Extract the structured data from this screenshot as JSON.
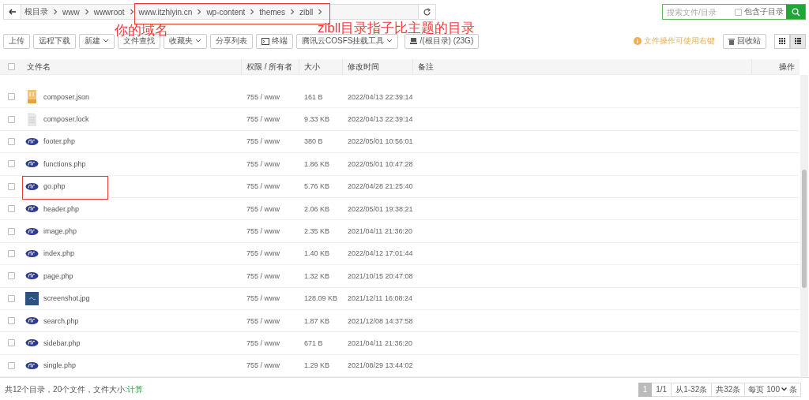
{
  "breadcrumb": {
    "segments": [
      "根目录",
      "www",
      "wwwroot",
      "www.itzhiyin.cn",
      "wp-content",
      "themes",
      "zibll"
    ]
  },
  "search": {
    "placeholder": "搜索文件/目录",
    "subdir_label": "包含子目录",
    "subdir_checked": false
  },
  "toolbar": {
    "buttons": [
      {
        "label": "上传",
        "kind": "plain"
      },
      {
        "label": "远程下载",
        "kind": "plain"
      },
      {
        "label": "新建",
        "kind": "dropdown"
      },
      {
        "label": "文件查找",
        "kind": "plain"
      },
      {
        "label": "收藏夹",
        "kind": "dropdown"
      },
      {
        "label": "分享列表",
        "kind": "plain"
      },
      {
        "label": "终端",
        "kind": "terminal"
      },
      {
        "label": "腾讯云COSFS挂载工具",
        "kind": "dropdown"
      },
      {
        "label": "/(根目录) (23G)",
        "kind": "disk"
      }
    ],
    "tip": "文件操作可使用右键",
    "recycle": "回收站",
    "views": [
      {
        "kind": "grid",
        "selected": false
      },
      {
        "kind": "list",
        "selected": true
      }
    ]
  },
  "table": {
    "select_all_checked": false,
    "columns": [
      "文件名",
      "权限 / 所有者",
      "大小",
      "修改时间",
      "备注",
      "操作"
    ],
    "rows": [
      {
        "name": "composer.json",
        "kind": "json",
        "perm": "755 / www",
        "size": "161 B",
        "mtime": "2022/04/13 22:39:14",
        "checked": false
      },
      {
        "name": "composer.lock",
        "kind": "file",
        "perm": "755 / www",
        "size": "9.33 KB",
        "mtime": "2022/04/13 22:39:14",
        "checked": false
      },
      {
        "name": "footer.php",
        "kind": "php",
        "perm": "755 / www",
        "size": "380 B",
        "mtime": "2022/05/01 10:56:01",
        "checked": false
      },
      {
        "name": "functions.php",
        "kind": "php",
        "perm": "755 / www",
        "size": "1.86 KB",
        "mtime": "2022/05/01 10:47:28",
        "checked": false
      },
      {
        "name": "go.php",
        "kind": "php",
        "perm": "755 / www",
        "size": "5.76 KB",
        "mtime": "2022/04/28 21:25:40",
        "checked": false
      },
      {
        "name": "header.php",
        "kind": "php",
        "perm": "755 / www",
        "size": "2.06 KB",
        "mtime": "2022/05/01 19:38:21",
        "checked": false
      },
      {
        "name": "image.php",
        "kind": "php",
        "perm": "755 / www",
        "size": "2.35 KB",
        "mtime": "2021/04/11 21:36:20",
        "checked": false
      },
      {
        "name": "index.php",
        "kind": "php",
        "perm": "755 / www",
        "size": "1.40 KB",
        "mtime": "2022/04/12 17:01:44",
        "checked": false
      },
      {
        "name": "page.php",
        "kind": "php",
        "perm": "755 / www",
        "size": "1.32 KB",
        "mtime": "2021/10/15 20:47:08",
        "checked": false
      },
      {
        "name": "screenshot.jpg",
        "kind": "image",
        "perm": "755 / www",
        "size": "128.09 KB",
        "mtime": "2021/12/11 16:08:24",
        "checked": false
      },
      {
        "name": "search.php",
        "kind": "php",
        "perm": "755 / www",
        "size": "1.87 KB",
        "mtime": "2021/12/08 14:37:58",
        "checked": false
      },
      {
        "name": "sidebar.php",
        "kind": "php",
        "perm": "755 / www",
        "size": "671 B",
        "mtime": "2021/04/11 21:36:20",
        "checked": false
      },
      {
        "name": "single.php",
        "kind": "php",
        "perm": "755 / www",
        "size": "1.29 KB",
        "mtime": "2021/08/29 13:44:02",
        "checked": false
      }
    ]
  },
  "footer": {
    "summary": "共12个目录，20个文件，文件大小: ",
    "calc_link": "计算",
    "page": "1",
    "page_count": "1/1",
    "range": "从1-32条",
    "total": "共32条",
    "per_page_label": "每页",
    "per_page": "100",
    "per_page_unit": "条"
  },
  "annotations": [
    {
      "kind": "crumb_box"
    },
    {
      "kind": "note",
      "text": "你的域名"
    },
    {
      "kind": "note",
      "text": "zibll目录指子比主题的目录"
    },
    {
      "kind": "file_box"
    }
  ]
}
